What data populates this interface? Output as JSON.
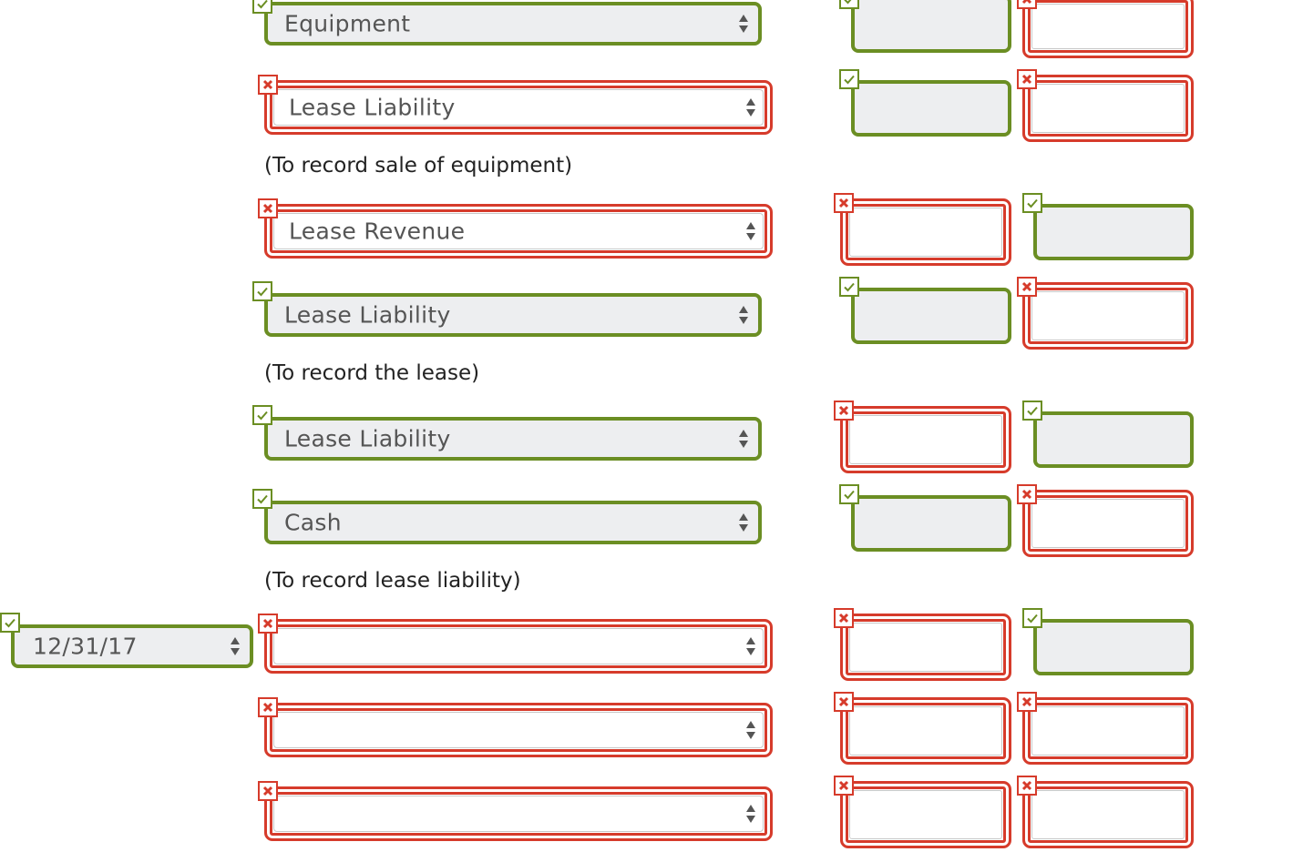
{
  "rows": [
    {
      "date": "",
      "account": "Equipment",
      "account_status": "correct",
      "debit_status": "correct",
      "credit_status": "incorrect"
    },
    {
      "date": "",
      "account": "Lease Liability",
      "account_status": "incorrect",
      "debit_status": "correct",
      "credit_status": "incorrect"
    },
    {
      "date": "",
      "account": "Lease Revenue",
      "account_status": "incorrect",
      "debit_status": "incorrect",
      "credit_status": "correct"
    },
    {
      "date": "",
      "account": "Lease Liability",
      "account_status": "correct",
      "debit_status": "correct",
      "credit_status": "incorrect"
    },
    {
      "date": "",
      "account": "Lease Liability",
      "account_status": "correct",
      "debit_status": "incorrect",
      "credit_status": "correct"
    },
    {
      "date": "",
      "account": "Cash",
      "account_status": "correct",
      "debit_status": "correct",
      "credit_status": "incorrect"
    },
    {
      "date": "12/31/17",
      "account": "",
      "account_status": "incorrect",
      "debit_status": "incorrect",
      "credit_status": "correct"
    },
    {
      "date": "",
      "account": "",
      "account_status": "incorrect",
      "debit_status": "incorrect",
      "credit_status": "incorrect"
    },
    {
      "date": "",
      "account": "",
      "account_status": "incorrect",
      "debit_status": "incorrect",
      "credit_status": "incorrect"
    }
  ],
  "notes": {
    "sale": "(To record sale of equipment)",
    "lease": "(To record the lease)",
    "liability": "(To record lease liability)"
  },
  "date_status": "correct",
  "icons": {
    "correct": "check-icon",
    "incorrect": "x-icon"
  },
  "colors": {
    "correct": "#6b8e23",
    "incorrect": "#d63b2b",
    "filled_bg": "#edeef0"
  }
}
